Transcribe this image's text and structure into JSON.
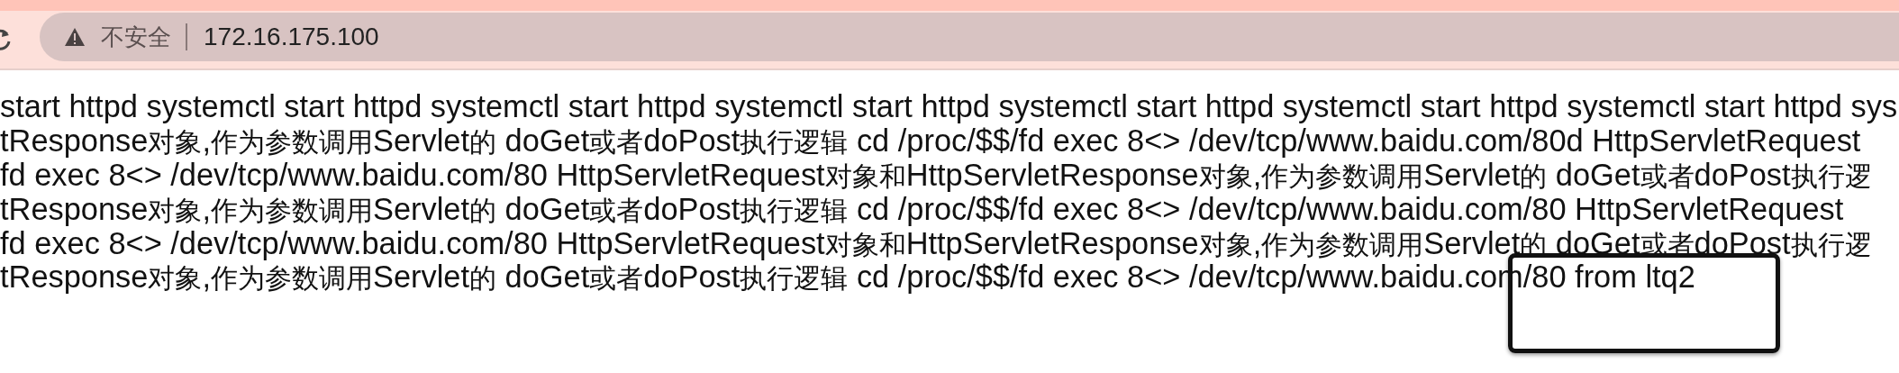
{
  "address_bar": {
    "security_label": "不安全",
    "url": "172.16.175.100"
  },
  "page_lines": [
    "start httpd systemctl start httpd systemctl start httpd systemctl start httpd systemctl start httpd systemctl start httpd systemctl start httpd sys",
    "tResponse对象,作为参数调用Servlet的 doGet或者doPost执行逻辑 cd /proc/$$/fd exec 8<> /dev/tcp/www.baidu.com/80d HttpServletRequest",
    "fd exec 8<> /dev/tcp/www.baidu.com/80 HttpServletRequest对象和HttpServletResponse对象,作为参数调用Servlet的 doGet或者doPost执行逻",
    "tResponse对象,作为参数调用Servlet的 doGet或者doPost执行逻辑 cd /proc/$$/fd exec 8<> /dev/tcp/www.baidu.com/80 HttpServletRequest",
    "fd exec 8<> /dev/tcp/www.baidu.com/80 HttpServletRequest对象和HttpServletResponse对象,作为参数调用Servlet的 doGet或者doPost执行逻",
    "tResponse对象,作为参数调用Servlet的 doGet或者doPost执行逻辑 cd /proc/$$/fd exec 8<> /dev/tcp/www.baidu.com/80 from ltq2"
  ]
}
